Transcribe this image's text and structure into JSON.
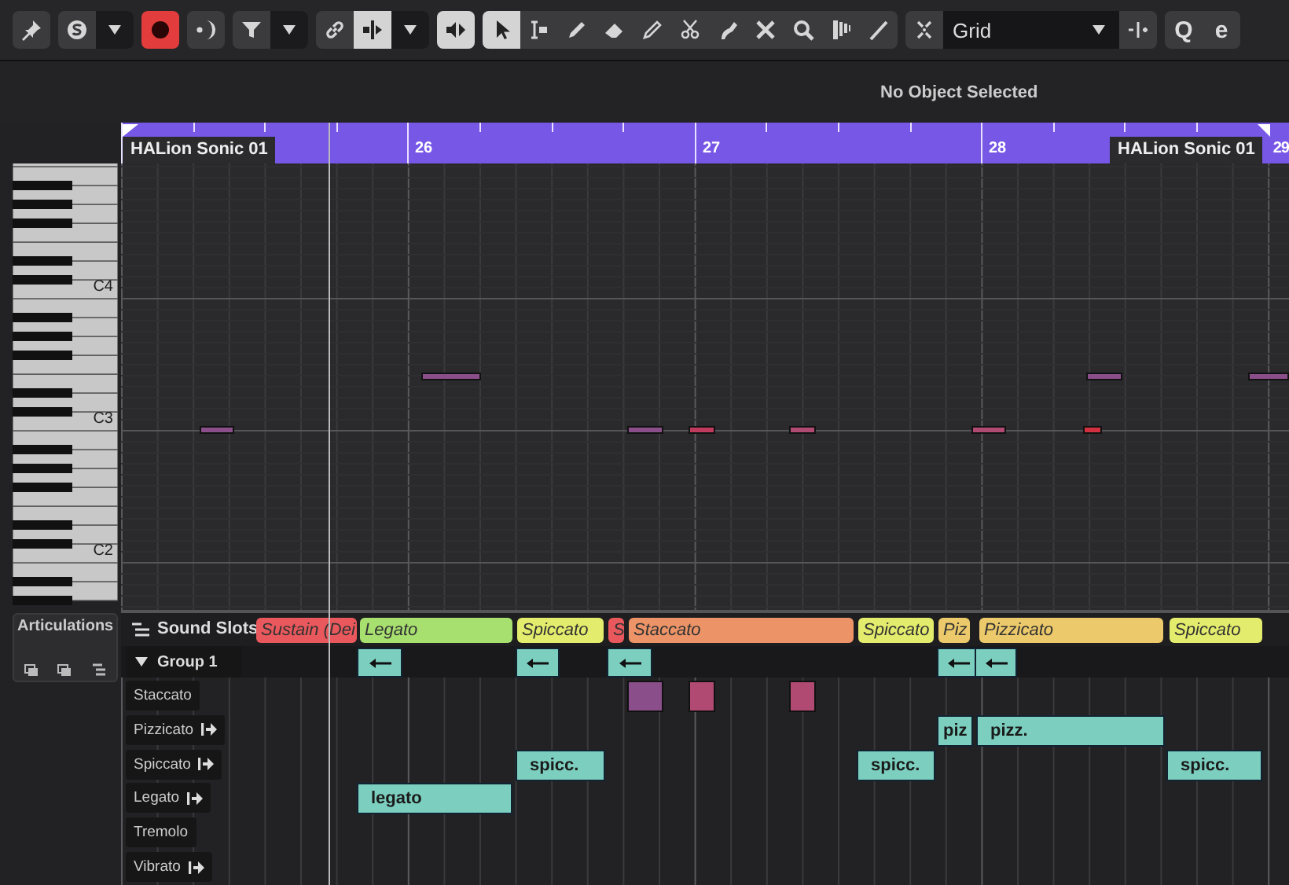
{
  "toolbar": [
    {
      "items": [
        {
          "kind": "pin",
          "on": false
        }
      ]
    },
    {
      "items": [
        {
          "kind": "solo",
          "on": false
        },
        {
          "kind": "dropdown",
          "on": false
        }
      ]
    },
    {
      "items": [
        {
          "kind": "record",
          "on": true
        }
      ]
    },
    {
      "items": [
        {
          "kind": "moon",
          "on": false
        }
      ]
    },
    {
      "items": [
        {
          "kind": "filter",
          "on": false
        },
        {
          "kind": "dropdown",
          "on": false
        }
      ]
    },
    {
      "items": [
        {
          "kind": "link",
          "on": false
        },
        {
          "kind": "split",
          "on": true
        },
        {
          "kind": "dropdown",
          "on": false
        }
      ]
    },
    {
      "items": [
        {
          "kind": "speaker",
          "on": true
        }
      ]
    },
    {
      "items": [
        {
          "kind": "arrow",
          "on": true
        },
        {
          "kind": "range",
          "on": false
        },
        {
          "kind": "pencil",
          "on": false
        },
        {
          "kind": "eraser",
          "on": false
        },
        {
          "kind": "pen",
          "on": false
        },
        {
          "kind": "scissors",
          "on": false
        },
        {
          "kind": "glue",
          "on": false
        },
        {
          "kind": "mute",
          "on": false
        },
        {
          "kind": "zoom",
          "on": false
        },
        {
          "kind": "comb",
          "on": false
        },
        {
          "kind": "line",
          "on": false
        }
      ]
    },
    {
      "items": [
        {
          "kind": "snap",
          "on": false
        },
        {
          "kind": "select",
          "value": "Grid"
        },
        {
          "kind": "insert",
          "on": false
        }
      ]
    },
    {
      "items": [
        {
          "kind": "letter",
          "label": "Q",
          "on": false
        },
        {
          "kind": "letter",
          "label": "e",
          "on": false
        }
      ]
    }
  ],
  "info_line": "No Object Selected",
  "ruler": {
    "bars": [
      "26",
      "27",
      "28",
      "29"
    ],
    "part_labels": [
      "HALion Sonic 01",
      "HALion Sonic 01"
    ]
  },
  "keyboard": {
    "labels": [
      "C4",
      "C3",
      "C2"
    ]
  },
  "articulations_panel": {
    "title": "Articulations"
  },
  "sound_slots": {
    "label": "Sound Slots",
    "slots": [
      {
        "label": "Sustain (Dei",
        "color": "#e9585c"
      },
      {
        "label": "Legato",
        "color": "#a8e070"
      },
      {
        "label": "Spiccato",
        "color": "#e3ec6c"
      },
      {
        "label": "S",
        "color": "#e9585c"
      },
      {
        "label": "Staccato",
        "color": "#ec9468"
      },
      {
        "label": "Spiccato",
        "color": "#e3ec6c"
      },
      {
        "label": "Piz",
        "color": "#ecc96a"
      },
      {
        "label": "Pizzicato",
        "color": "#ecc96a"
      },
      {
        "label": "Spiccato",
        "color": "#e3ec6c"
      }
    ]
  },
  "group": {
    "label": "Group 1",
    "expanded": true
  },
  "lanes": [
    {
      "name": "Staccato",
      "kind": "attribute"
    },
    {
      "name": "Pizzicato",
      "kind": "direction",
      "events": [
        {
          "label": "piz"
        },
        {
          "label": "pizz."
        }
      ]
    },
    {
      "name": "Spiccato",
      "kind": "direction",
      "events": [
        {
          "label": "spicc."
        },
        {
          "label": "spicc."
        },
        {
          "label": "spicc."
        }
      ]
    },
    {
      "name": "Legato",
      "kind": "direction",
      "events": [
        {
          "label": "legato"
        }
      ]
    },
    {
      "name": "Tremolo",
      "kind": "attribute"
    },
    {
      "name": "Vibrato",
      "kind": "direction"
    }
  ]
}
